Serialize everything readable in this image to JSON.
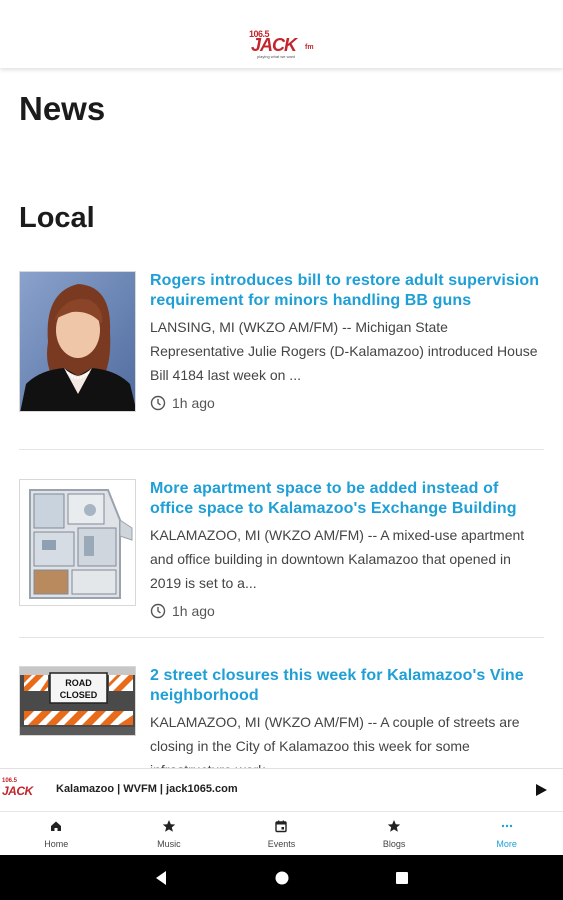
{
  "header": {
    "logo": {
      "number": "106.5",
      "word": "JACK",
      "suffix": "fm",
      "tagline": "playing what we want"
    }
  },
  "page": {
    "title": "News",
    "section": "Local"
  },
  "articles": [
    {
      "headline": "Rogers introduces bill to restore adult supervision requirement for minors handling BB guns",
      "excerpt": "LANSING, MI (WKZO AM/FM) -- Michigan State Representative Julie Rogers (D-Kalamazoo) introduced House Bill 4184 last week on ...",
      "time": "1h ago",
      "image": "portrait-photo"
    },
    {
      "headline": "More apartment space to be added instead of office space to Kalamazoo's Exchange Building",
      "excerpt": "KALAMAZOO, MI (WKZO AM/FM) -- A mixed-use apartment and office building in downtown Kalamazoo that opened in 2019 is set to a...",
      "time": "1h ago",
      "image": "floorplan-render"
    },
    {
      "headline": "2 street closures this week for Kalamazoo's Vine neighborhood",
      "excerpt": "KALAMAZOO, MI (WKZO AM/FM) -- A couple of streets are closing in the City of Kalamazoo this week for some infrastructure work",
      "time": "",
      "image": "road-closed-sign",
      "sign_text": [
        "ROAD",
        "CLOSED"
      ]
    }
  ],
  "player": {
    "station": "Kalamazoo | WVFM | jack1065.com",
    "logo_number": "106.5",
    "logo_word": "JACK",
    "action_icon": "play-icon"
  },
  "tabs": [
    {
      "label": "Home",
      "icon": "home-icon"
    },
    {
      "label": "Music",
      "icon": "star-icon"
    },
    {
      "label": "Events",
      "icon": "calendar-icon"
    },
    {
      "label": "Blogs",
      "icon": "star-icon"
    },
    {
      "label": "More",
      "icon": "more-icon",
      "active": true
    }
  ],
  "colors": {
    "accent": "#1e9fd6",
    "brand": "#c2252c",
    "navbar": "#000000"
  },
  "system_nav": [
    "back-icon",
    "home-circle-icon",
    "recents-icon"
  ]
}
